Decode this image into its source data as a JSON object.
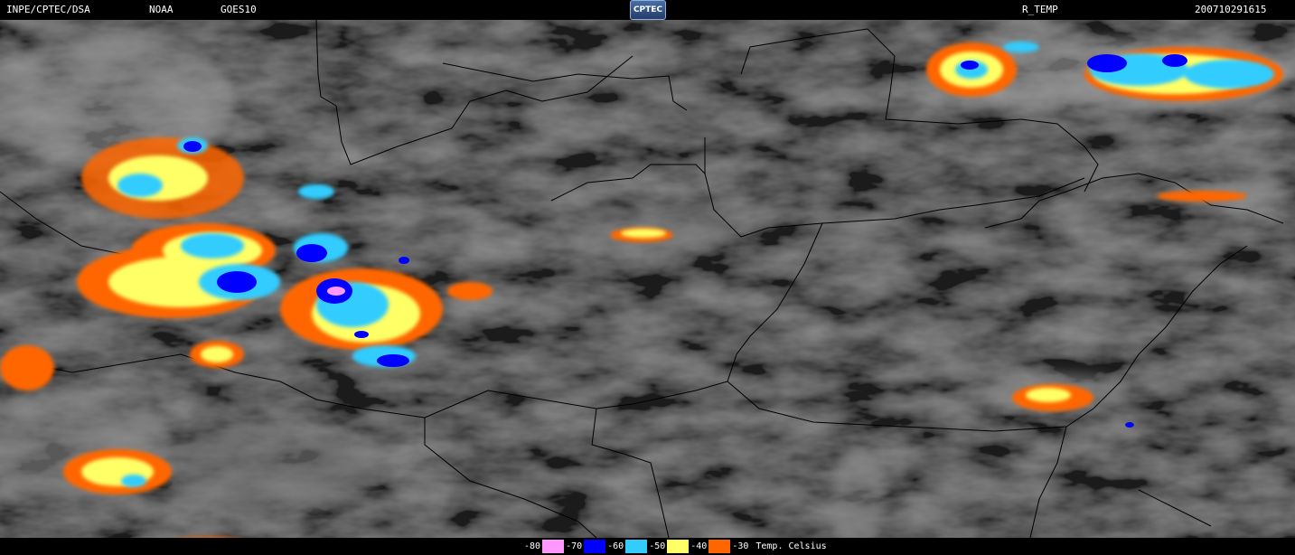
{
  "header": {
    "source": "INPE/CPTEC/DSA",
    "agency": "NOAA",
    "satellite": "GOES10",
    "product": "R_TEMP",
    "timestamp": "200710291615",
    "logo_text": "CPTEC"
  },
  "legend": {
    "unit": "Temp. Celsius",
    "entries": [
      {
        "label": "-80",
        "color": "#ff99ff"
      },
      {
        "label": "-70",
        "color": "#0000ff"
      },
      {
        "label": "-60",
        "color": "#33ccff"
      },
      {
        "label": "-50",
        "color": "#ffff66"
      },
      {
        "label": "-40",
        "color": "#ff6600"
      },
      {
        "label": "-30",
        "color": null
      }
    ]
  }
}
